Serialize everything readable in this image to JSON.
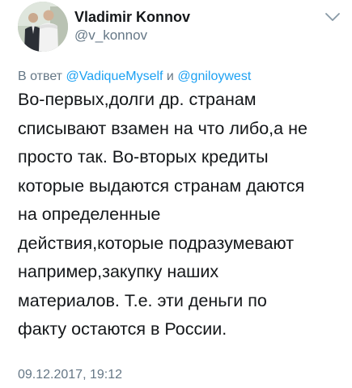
{
  "author": {
    "display_name": "Vladimir Konnov",
    "handle": "@v_konnov",
    "avatar": "profile-photo"
  },
  "menu_icon": "chevron-down-icon",
  "reply": {
    "prefix": "В ответ",
    "mention_1": "@VadiqueMyself",
    "conjunction": "и",
    "mention_2": "@gniloywest"
  },
  "tweet_lines": [
    "Во-первых,долги др. странам",
    "списывают взамен на что либо,а не",
    "просто так. Во-вторых кредиты",
    "которые выдаются странам даются",
    "на определенные",
    "действия,которые подразумевают",
    "например,закупку наших",
    "материалов. Т.е. эти деньги по",
    "факту остаются в России."
  ],
  "timestamp": "09.12.2017, 19:12",
  "colors": {
    "text": "#14171a",
    "secondary": "#657786",
    "link": "#1da1f2"
  }
}
